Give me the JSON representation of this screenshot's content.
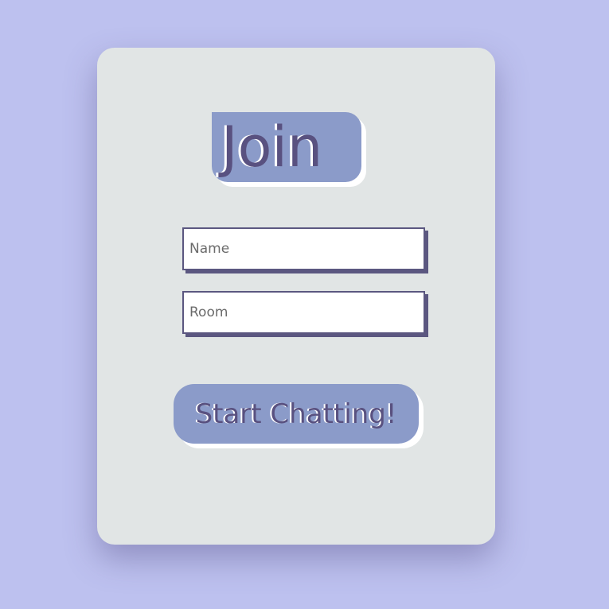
{
  "join": {
    "heading": "Join"
  },
  "form": {
    "name_placeholder": "Name",
    "name_value": "",
    "room_placeholder": "Room",
    "room_value": "",
    "submit_label": "Start Chatting!"
  },
  "colors": {
    "page_background": "#bdc1ef",
    "card_background": "#e1e5e5",
    "accent": "#8b9bc9",
    "accent_text": "#595180",
    "input_border": "#5b5780"
  }
}
